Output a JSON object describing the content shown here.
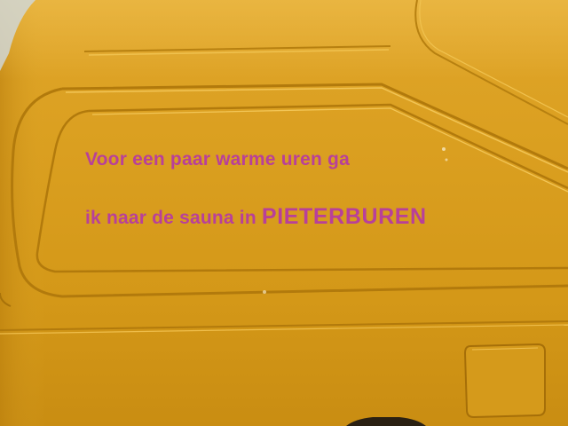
{
  "decal": {
    "line1": "Voor een paar warme uren ga",
    "line2_prefix": "ik naar de sauna in",
    "line2_place": "PIETERBUREN"
  },
  "colors": {
    "van_paint": "#dba021",
    "decal_text": "#b8409a"
  }
}
